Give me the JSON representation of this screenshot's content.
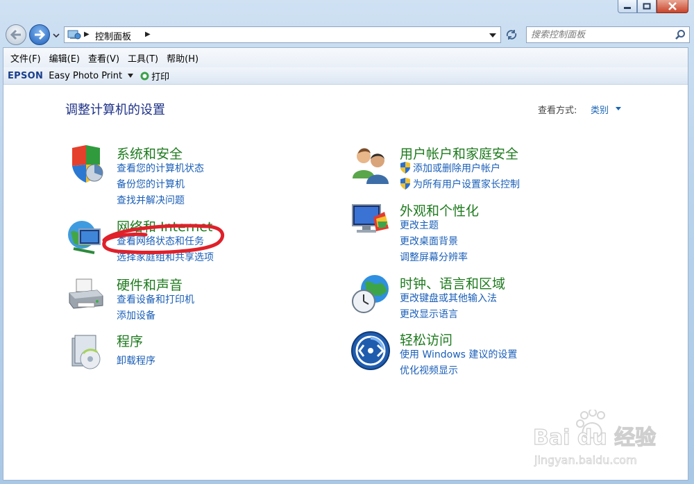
{
  "address": {
    "breadcrumb": "控制面板",
    "search_placeholder": "搜索控制面板"
  },
  "menu": [
    "文件(F)",
    "编辑(E)",
    "查看(V)",
    "工具(T)",
    "帮助(H)"
  ],
  "epson_bar": {
    "brand": "EPSON",
    "app": "Easy Photo Print",
    "print": "打印"
  },
  "page": {
    "title": "调整计算机的设置",
    "view_by_label": "查看方式:",
    "view_by_value": "类别"
  },
  "categories": [
    {
      "title": "系统和安全",
      "links": [
        "查看您的计算机状态",
        "备份您的计算机",
        "查找并解决问题"
      ]
    },
    {
      "title": "网络和 Internet",
      "links": [
        "查看网络状态和任务",
        "选择家庭组和共享选项"
      ]
    },
    {
      "title": "硬件和声音",
      "links": [
        "查看设备和打印机",
        "添加设备"
      ]
    },
    {
      "title": "程序",
      "links": [
        "卸载程序"
      ]
    },
    {
      "title": "用户帐户和家庭安全",
      "links": [
        "添加或删除用户帐户",
        "为所有用户设置家长控制"
      ]
    },
    {
      "title": "外观和个性化",
      "links": [
        "更改主题",
        "更改桌面背景",
        "调整屏幕分辨率"
      ]
    },
    {
      "title": "时钟、语言和区域",
      "links": [
        "更改键盘或其他输入法",
        "更改显示语言"
      ]
    },
    {
      "title": "轻松访问",
      "links": [
        "使用 Windows 建议的设置",
        "优化视频显示"
      ]
    }
  ],
  "watermark": {
    "brand": "Baidu经验",
    "url": "jingyan.baidu.com"
  },
  "colors": {
    "category_title": "#1e7a1e",
    "link": "#1a5fb8",
    "page_title": "#1e3287",
    "annotation": "#e0202a"
  }
}
